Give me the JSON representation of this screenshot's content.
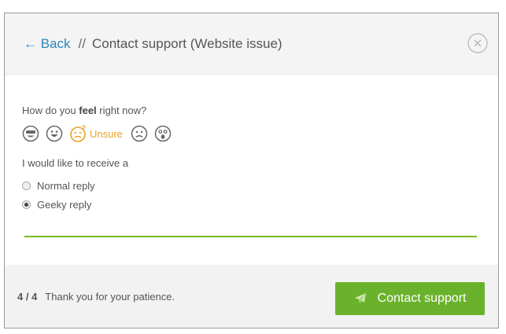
{
  "header": {
    "back_label": "← Back",
    "separator": "//",
    "title": "Contact support (Website issue)"
  },
  "feel": {
    "question_prefix": "How do you ",
    "question_bold": "feel",
    "question_suffix": " right now?",
    "moods": [
      "cool-face",
      "happy-face",
      "unsure-face",
      "sad-face",
      "shocked-face"
    ],
    "selected_label": "Unsure"
  },
  "reply": {
    "label": "I would like to receive a",
    "options": [
      {
        "label": "Normal reply",
        "checked": false
      },
      {
        "label": "Geeky reply",
        "checked": true
      }
    ]
  },
  "progress": {
    "fraction": 1.0
  },
  "footer": {
    "step": "4 / 4",
    "message": "Thank you for your patience.",
    "button_label": "Contact support"
  },
  "colors": {
    "link": "#2a86b8",
    "accent_green": "#6bb22c",
    "unsure_orange": "#e8a22a"
  }
}
